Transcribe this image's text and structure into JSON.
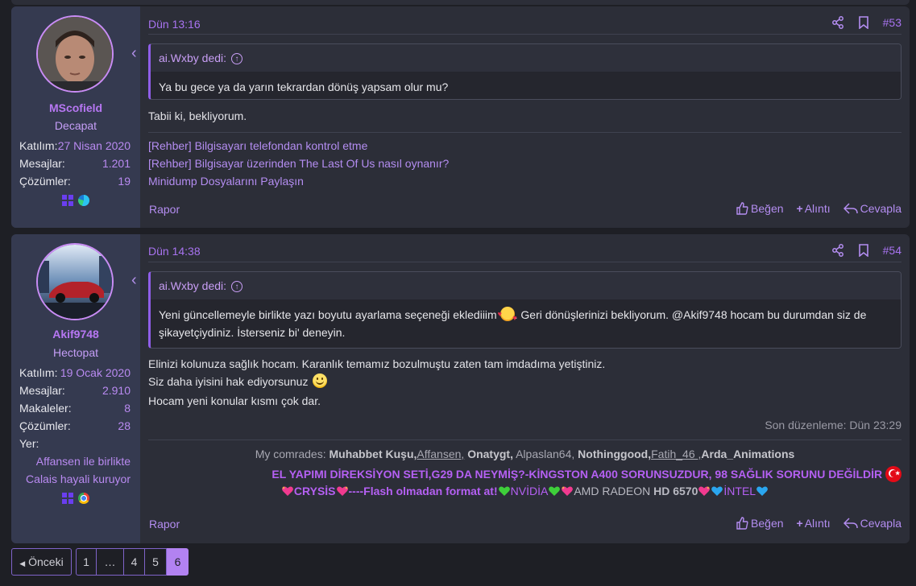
{
  "posts": [
    {
      "user": {
        "name": "MScofield",
        "title": "Decapat",
        "stats": [
          {
            "key": "Katılım:",
            "value": "27 Nisan 2020"
          },
          {
            "key": "Mesajlar:",
            "value": "1.201"
          },
          {
            "key": "Çözümler:",
            "value": "19"
          }
        ],
        "devices": [
          "windows-icon",
          "edge-icon"
        ]
      },
      "date": "Dün 13:16",
      "number": "#53",
      "quote": {
        "author": "ai.Wxby dedi:",
        "text": "Ya bu gece ya da yarın tekrardan dönüş yapsam olur mu?"
      },
      "body": [
        "Tabii ki, bekliyorum."
      ],
      "signature_links": [
        "[Rehber] Bilgisayarı telefondan kontrol etme",
        "[Rehber] Bilgisayar üzerinden The Last Of Us nasıl oynanır?",
        "Minidump Dosyalarını Paylaşın"
      ],
      "report": "Rapor",
      "actions": {
        "like": "Beğen",
        "quote": "Alıntı",
        "reply": "Cevapla"
      }
    },
    {
      "user": {
        "name": "Akif9748",
        "title": "Hectopat",
        "stats": [
          {
            "key": "Katılım:",
            "value": "19 Ocak 2020"
          },
          {
            "key": "Mesajlar:",
            "value": "2.910"
          },
          {
            "key": "Makaleler:",
            "value": "8"
          },
          {
            "key": "Çözümler:",
            "value": "28"
          },
          {
            "key": "Yer:",
            "value": ""
          }
        ],
        "location_lines": [
          "Affansen ile birlikte",
          "Calais hayali kuruyor"
        ],
        "devices": [
          "windows-icon",
          "chrome-icon"
        ]
      },
      "date": "Dün 14:38",
      "number": "#54",
      "quote": {
        "author": "ai.Wxby dedi:",
        "text_before": "Yeni güncellemeyle birlikte yazı boyutu ayarlama seçeneği eklediiim",
        "text_after": ". Geri dönüşlerinizi bekliyorum. @Akif9748 hocam bu durumdan siz de",
        "text_line2": "şikayetçiydiniz. İsterseniz bi' deneyin."
      },
      "body": [
        "Elinizi kolunuza sağlık hocam. Karanlık temamız bozulmuştu zaten tam imdadıma yetiştiniz.",
        "Siz daha iyisini hak ediyorsunuz",
        "Hocam yeni konular kısmı çok dar."
      ],
      "edited": "Son düzenleme: Dün 23:29",
      "signature": {
        "comrades_label": "My comrades:",
        "comrades": [
          "Muhabbet Kuşu,",
          "Affansen,",
          "Onatygt,",
          "Alpaslan64,",
          "Nothinggood,",
          "Fatih_46 ,",
          "Arda_Animations"
        ],
        "line2": "EL YAPIMI DİREKSİYON SETİ,G29 DA NEYMİŞ?-KİNGSTON A400 SORUNSUZDUR, 98 SAĞLIK SORUNU DEĞİLDİR",
        "line3": {
          "crysis": "CRYSİS",
          "flash": "----Flash olmadan format at!",
          "nvidia": "NVİDİA",
          "amd": "AMD RADEON",
          "hd": "HD 6570",
          "intel": "İNTEL"
        }
      },
      "report": "Rapor",
      "actions": {
        "like": "Beğen",
        "quote": "Alıntı",
        "reply": "Cevapla"
      }
    }
  ],
  "pagination": {
    "prev": "Önceki",
    "pages": [
      "1",
      "…",
      "4",
      "5",
      "6"
    ],
    "current": "6"
  },
  "colors": {
    "accent": "#b282f1",
    "panel": "#2c2e38",
    "user_panel": "#353a50"
  }
}
